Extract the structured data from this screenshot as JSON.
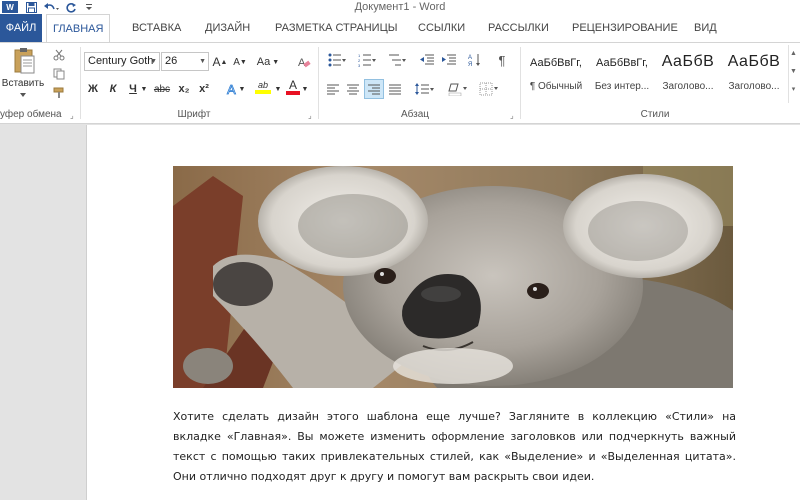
{
  "app": {
    "window_title": "Документ1 - Word",
    "logo_text": "W"
  },
  "quick_access": {
    "save_icon": "save-icon",
    "undo_icon": "undo-icon",
    "redo_icon": "redo-icon",
    "customize_icon": "customize-icon"
  },
  "tabs": [
    {
      "label": "ФАЙЛ"
    },
    {
      "label": "ГЛАВНАЯ"
    },
    {
      "label": "ВСТАВКА"
    },
    {
      "label": "ДИЗАЙН"
    },
    {
      "label": "РАЗМЕТКА СТРАНИЦЫ"
    },
    {
      "label": "ССЫЛКИ"
    },
    {
      "label": "РАССЫЛКИ"
    },
    {
      "label": "РЕЦЕНЗИРОВАНИЕ"
    },
    {
      "label": "ВИД"
    }
  ],
  "active_tab": "ГЛАВНАЯ",
  "ribbon": {
    "clipboard": {
      "paste_label": "Вставить",
      "group_label": "уфер обмена"
    },
    "font": {
      "font_name": "Century Goth",
      "font_size": "26",
      "case_label": "Aa",
      "bold": "Ж",
      "italic": "К",
      "underline": "Ч",
      "strike": "abc",
      "subscript": "x₂",
      "superscript": "x²",
      "grow": "A",
      "shrink": "A",
      "highlight_label": "ab",
      "color_label": "A",
      "group_label": "Шрифт"
    },
    "paragraph": {
      "group_label": "Абзац",
      "pilcrow": "¶"
    },
    "styles": {
      "group_label": "Стили",
      "items": [
        {
          "sample": "АаБбВвГг,",
          "name": "¶ Обычный"
        },
        {
          "sample": "АаБбВвГг,",
          "name": "Без интер..."
        },
        {
          "sample": "АаБбВ",
          "name": "Заголово..."
        },
        {
          "sample": "АаБбВ",
          "name": "Заголово..."
        }
      ]
    }
  },
  "document": {
    "body_text": "Хотите сделать дизайн этого шаблона еще лучше? Загляните в коллекцию «Стили» на вкладке «Главная». Вы можете изменить оформление заголовков или подчеркнуть важный текст с помощью таких привлекательных стилей, как «Выделение» и «Выделенная цитата». Они отлично подходят друг к другу и помогут вам раскрыть свои идеи."
  },
  "colors": {
    "accent": "#2b579a",
    "font_color_bar": "#e81123",
    "highlight_bar": "#ffff00"
  }
}
